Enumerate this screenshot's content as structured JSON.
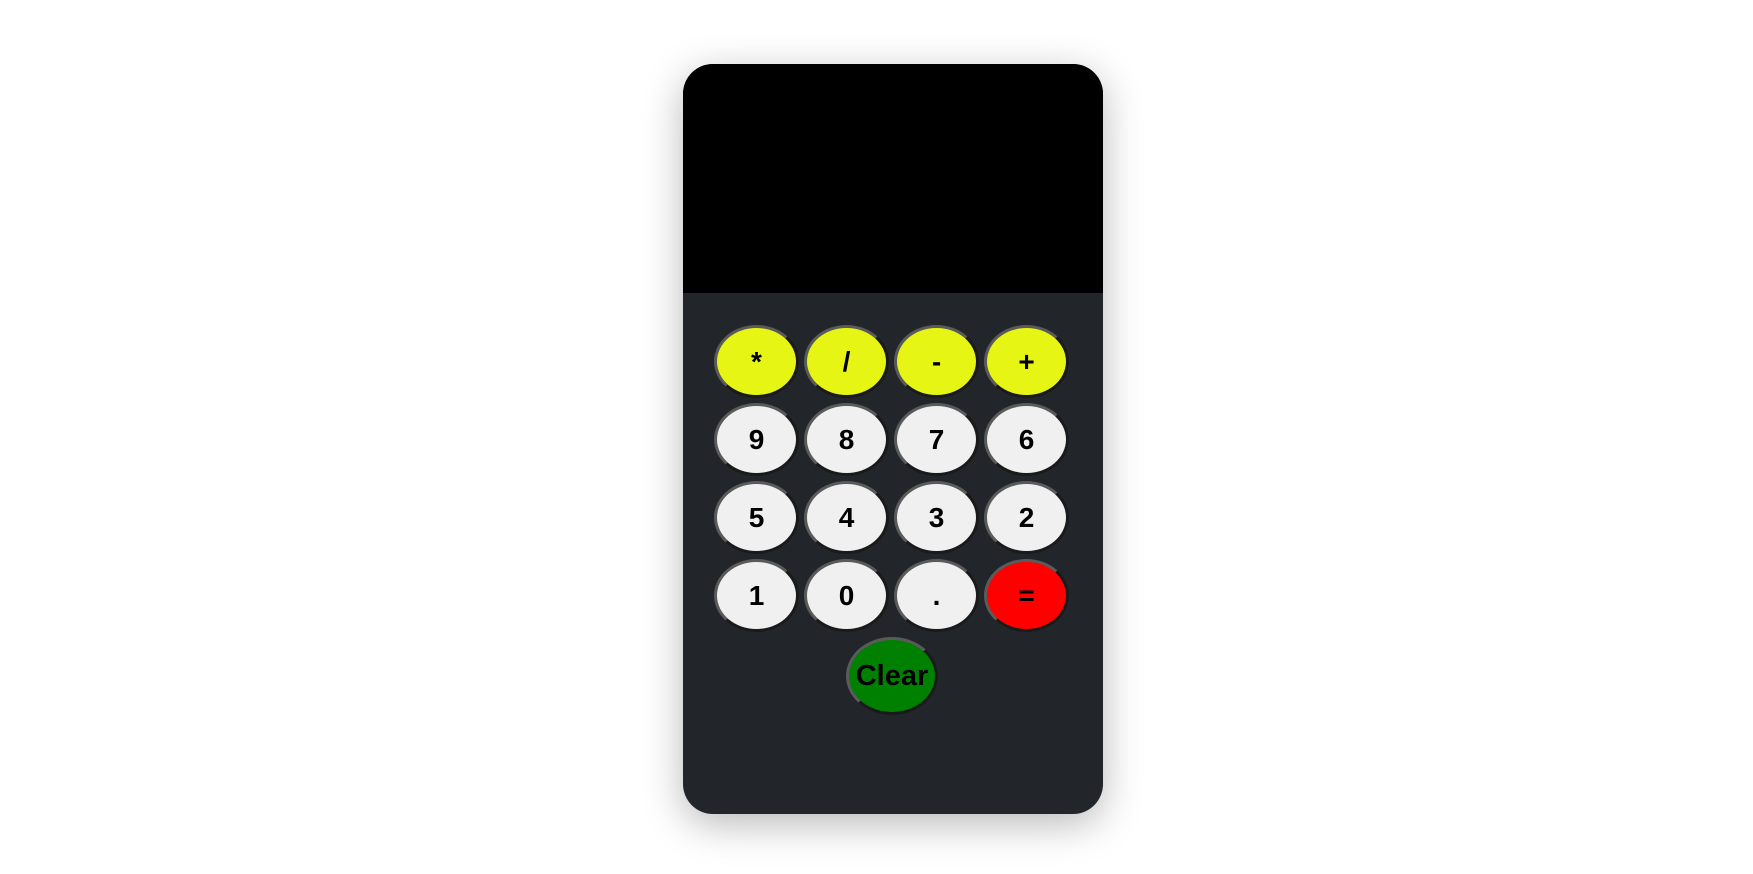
{
  "display": {
    "value": ""
  },
  "keys": {
    "operators": [
      "*",
      "/",
      "-",
      "+"
    ],
    "row1": [
      "9",
      "8",
      "7",
      "6"
    ],
    "row2": [
      "5",
      "4",
      "3",
      "2"
    ],
    "row3": [
      "1",
      "0",
      "."
    ],
    "equals": "=",
    "clear": "Clear"
  },
  "colors": {
    "operator": "#e6f514",
    "number": "#f0f0f0",
    "equals": "#ff0000",
    "clear": "#008000",
    "display": "#000000",
    "body": "#22262b"
  }
}
